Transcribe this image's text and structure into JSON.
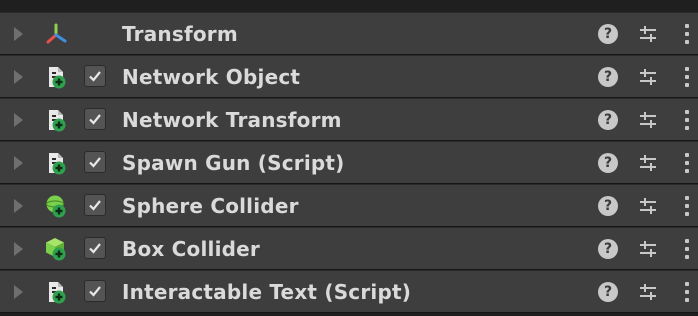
{
  "inspector": {
    "components": [
      {
        "name": "Transform",
        "icon": "transform-axes-icon",
        "has_toggle": false
      },
      {
        "name": "Network Object",
        "icon": "script-file-icon",
        "has_toggle": true,
        "enabled": true
      },
      {
        "name": "Network Transform",
        "icon": "script-file-icon",
        "has_toggle": true,
        "enabled": true
      },
      {
        "name": "Spawn Gun (Script)",
        "icon": "script-file-icon",
        "has_toggle": true,
        "enabled": true
      },
      {
        "name": "Sphere Collider",
        "icon": "sphere-collider-icon",
        "has_toggle": true,
        "enabled": true
      },
      {
        "name": "Box Collider",
        "icon": "box-collider-icon",
        "has_toggle": true,
        "enabled": true
      },
      {
        "name": "Interactable Text (Script)",
        "icon": "script-file-icon",
        "has_toggle": true,
        "enabled": true
      }
    ],
    "help_glyph": "?"
  },
  "colors": {
    "row_background": "#3e3e3e",
    "text": "#dadada",
    "collider_green": "#7bd14b",
    "plus_badge_green": "#2fa04d"
  }
}
